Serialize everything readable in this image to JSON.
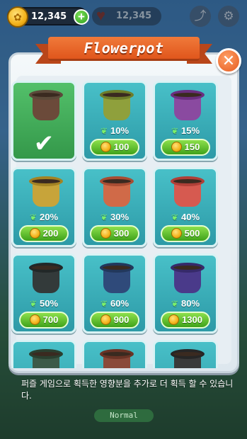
{
  "hud": {
    "coins": "12,345",
    "hearts": "12,345"
  },
  "modal": {
    "title": "Flowerpot",
    "close_symbol": "✕"
  },
  "pots": [
    {
      "bonus": "",
      "price": "",
      "selected": true,
      "pot_color": "#6b4a3a",
      "rim_color": "#5b4a3a"
    },
    {
      "bonus": "10%",
      "price": "100",
      "selected": false,
      "pot_color": "#8fa03c",
      "rim_color": "#6e7d2a"
    },
    {
      "bonus": "15%",
      "price": "150",
      "selected": false,
      "pot_color": "#8a4aa0",
      "rim_color": "#6a2f80"
    },
    {
      "bonus": "20%",
      "price": "200",
      "selected": false,
      "pot_color": "#c7a43a",
      "rim_color": "#a38324"
    },
    {
      "bonus": "30%",
      "price": "300",
      "selected": false,
      "pot_color": "#d06a48",
      "rim_color": "#a84d33"
    },
    {
      "bonus": "40%",
      "price": "500",
      "selected": false,
      "pot_color": "#d65a50",
      "rim_color": "#b04038"
    },
    {
      "bonus": "50%",
      "price": "700",
      "selected": false,
      "pot_color": "#333a3a",
      "rim_color": "#222828"
    },
    {
      "bonus": "60%",
      "price": "900",
      "selected": false,
      "pot_color": "#2f4a7a",
      "rim_color": "#22385c"
    },
    {
      "bonus": "80%",
      "price": "1300",
      "selected": false,
      "pot_color": "#4a3a8a",
      "rim_color": "#362a6a"
    },
    {
      "bonus": "",
      "price": "",
      "selected": false,
      "pot_color": "#3c5a48",
      "rim_color": "#2a4030"
    },
    {
      "bonus": "",
      "price": "",
      "selected": false,
      "pot_color": "#8a4a3a",
      "rim_color": "#6a3426"
    },
    {
      "bonus": "",
      "price": "",
      "selected": false,
      "pot_color": "#3a3a3a",
      "rim_color": "#262626"
    }
  ],
  "description": "퍼즐 게임으로 획득한 영향분을 추가로 더 획득 할 수 있습니다.",
  "mode_label": "Normal",
  "colors": {
    "card_teal": "#2d9aa7",
    "card_selected": "#34984a",
    "price_green": "#3fa21a",
    "ribbon_orange": "#e0561c"
  }
}
